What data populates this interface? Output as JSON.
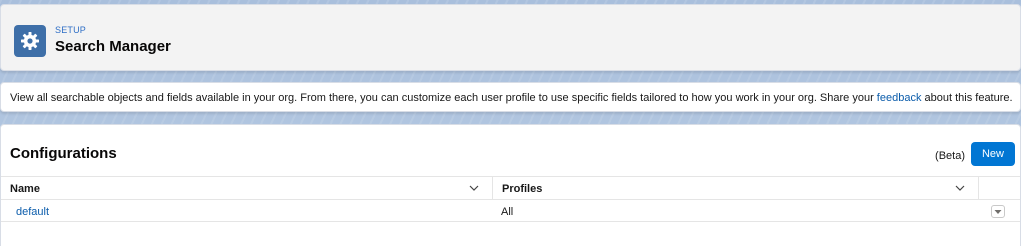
{
  "header": {
    "eyebrow": "SETUP",
    "title": "Search Manager",
    "icon": "gear-icon"
  },
  "info": {
    "text_before": "View all searchable objects and fields available in your org. From there, you can customize each user profile to use specific fields tailored to how you work in your org. Share your ",
    "link": "feedback",
    "text_after": " about this feature."
  },
  "configurations": {
    "title": "Configurations",
    "beta_label": "(Beta)",
    "new_button": "New",
    "columns": [
      "Name",
      "Profiles"
    ],
    "rows": [
      {
        "name": "default",
        "profiles": "All"
      }
    ]
  },
  "colors": {
    "accent": "#0176d3",
    "link": "#0b5cab",
    "icon_bg": "#3e6fa8"
  }
}
